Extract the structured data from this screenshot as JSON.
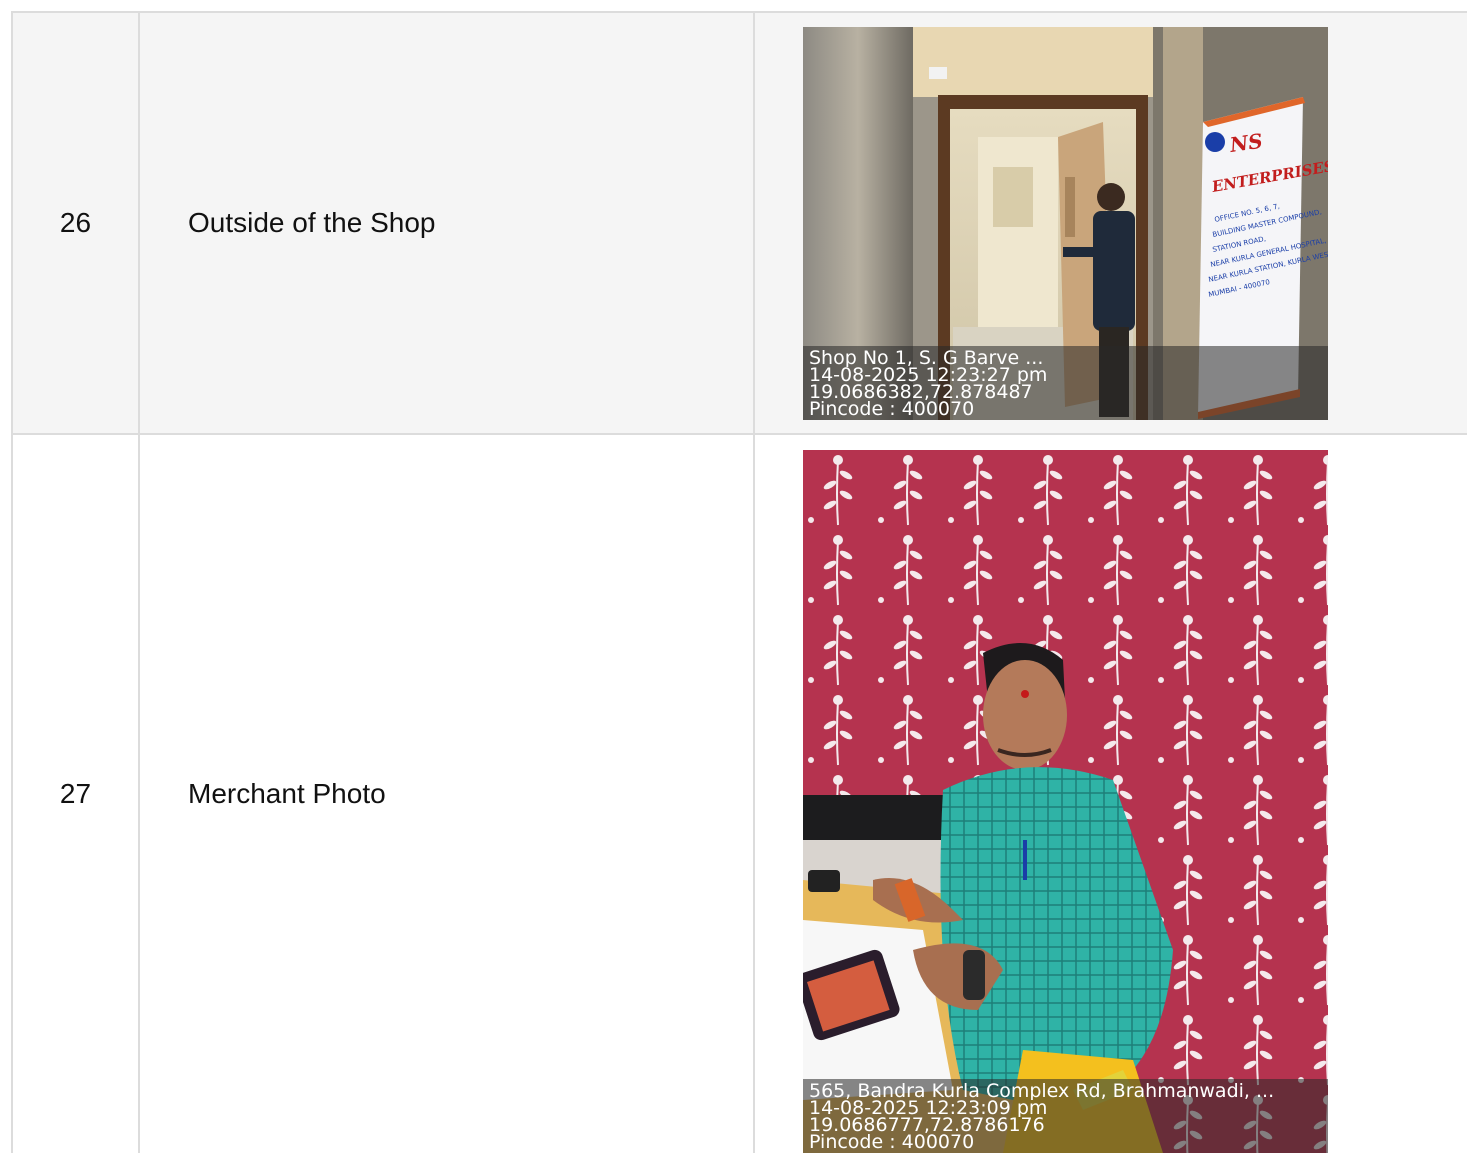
{
  "rows": [
    {
      "number": "26",
      "label": "Outside of the Shop",
      "photo": {
        "stamp": [
          "Shop No 1, S. G Barve ...",
          "14-08-2025 12:23:27 pm",
          "19.0686382,72.878487",
          "Pincode : 400070"
        ],
        "sign_text": [
          "NS",
          "ENTERPRISES",
          "OFFICE NO. 5, 6, 7,",
          "BUILDING MASTER COMPOUND,",
          "STATION ROAD,",
          "NEAR KURLA GENERAL HOSPITAL,",
          "NEAR KURLA STATION, KURLA WEST,",
          "MUMBAI - 400070"
        ]
      }
    },
    {
      "number": "27",
      "label": "Merchant Photo",
      "photo": {
        "stamp": [
          "565, Bandra Kurla Complex Rd, Brahmanwadi, ...",
          "14-08-2025 12:23:09 pm",
          "19.0686777,72.8786176",
          "Pincode : 400070"
        ]
      }
    }
  ]
}
